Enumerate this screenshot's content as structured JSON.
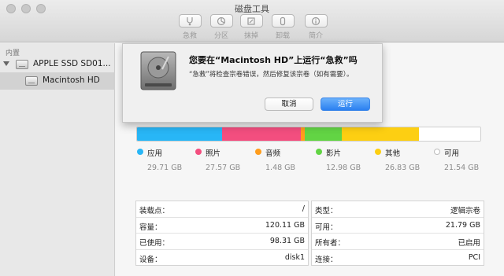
{
  "window": {
    "title": "磁盘工具"
  },
  "toolbar": {
    "items": [
      {
        "label": "急救",
        "icon": "first-aid-stethoscope-icon"
      },
      {
        "label": "分区",
        "icon": "partition-pie-icon"
      },
      {
        "label": "抹掉",
        "icon": "erase-icon"
      },
      {
        "label": "卸载",
        "icon": "eject-icon"
      },
      {
        "label": "简介",
        "icon": "info-icon"
      }
    ]
  },
  "sidebar": {
    "header": "内置",
    "disk": "APPLE SSD SD01...",
    "volume": "Macintosh HD"
  },
  "dialog": {
    "title": "您要在“Macintosh HD”上运行“急救”吗",
    "message": "“急救”将检查宗卷错误，然后修复该宗卷（如有需要）。",
    "cancel_label": "取消",
    "run_label": "运行"
  },
  "usage": {
    "segments": [
      {
        "label": "应用",
        "size": "29.71 GB",
        "gb": 29.71,
        "color": "#28b6f6"
      },
      {
        "label": "照片",
        "size": "27.57 GB",
        "gb": 27.57,
        "color": "#f34e7f"
      },
      {
        "label": "音频",
        "size": "1.48 GB",
        "gb": 1.48,
        "color": "#ff9d1c"
      },
      {
        "label": "影片",
        "size": "12.98 GB",
        "gb": 12.98,
        "color": "#62d444"
      },
      {
        "label": "其他",
        "size": "26.83 GB",
        "gb": 26.83,
        "color": "#fdcf12"
      },
      {
        "label": "可用",
        "size": "21.54 GB",
        "gb": 21.54,
        "color": "#ffffff"
      }
    ]
  },
  "info": {
    "left": [
      {
        "key": "装载点：",
        "value": "/"
      },
      {
        "key": "容量：",
        "value": "120.11 GB"
      },
      {
        "key": "已使用：",
        "value": "98.31 GB"
      },
      {
        "key": "设备：",
        "value": "disk1"
      }
    ],
    "right": [
      {
        "key": "类型：",
        "value": "逻辑宗卷"
      },
      {
        "key": "可用：",
        "value": "21.79 GB"
      },
      {
        "key": "所有者：",
        "value": "已启用"
      },
      {
        "key": "连接：",
        "value": "PCI"
      }
    ]
  }
}
